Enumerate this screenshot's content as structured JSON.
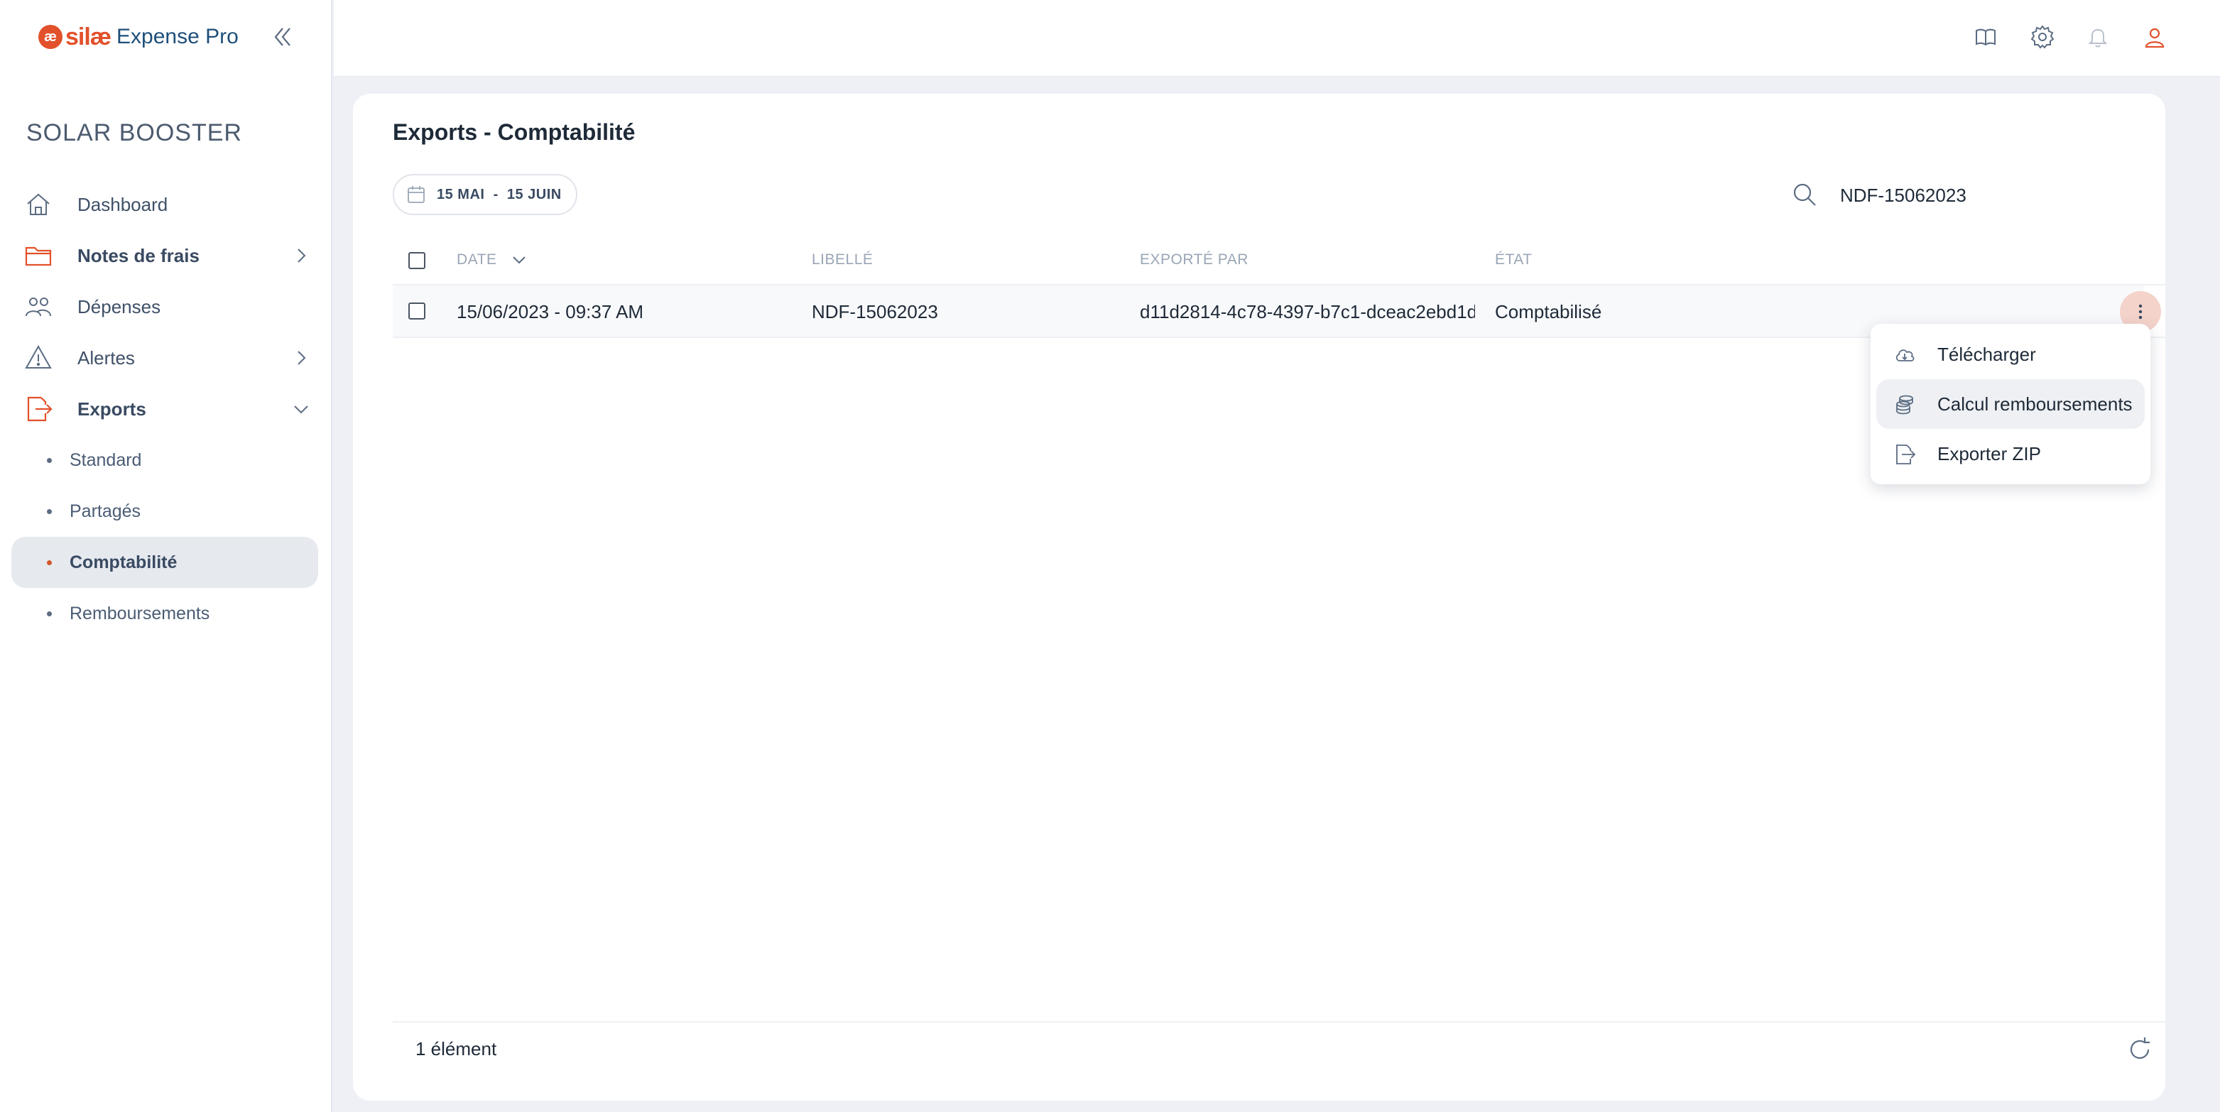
{
  "app": {
    "logo_mark": "æ",
    "logo_brand": "silæ",
    "logo_product": "Expense Pro",
    "org_name": "SOLAR BOOSTER"
  },
  "sidebar": {
    "items": [
      {
        "label": "Dashboard",
        "icon": "home-icon"
      },
      {
        "label": "Notes de frais",
        "icon": "folder-icon",
        "expandable": true
      },
      {
        "label": "Dépenses",
        "icon": "users-icon"
      },
      {
        "label": "Alertes",
        "icon": "warning-icon",
        "expandable": true
      },
      {
        "label": "Exports",
        "icon": "export-icon",
        "expanded": true
      }
    ],
    "sub_items": [
      {
        "label": "Standard"
      },
      {
        "label": "Partagés"
      },
      {
        "label": "Comptabilité",
        "active": true
      },
      {
        "label": "Remboursements"
      }
    ]
  },
  "topbar": {
    "icons": [
      "book-icon",
      "settings-icon",
      "bell-icon",
      "user-icon"
    ]
  },
  "page": {
    "title": "Exports - Comptabilité",
    "date_range": "15 MAI  -  15 JUIN",
    "search_value": "NDF-15062023"
  },
  "table": {
    "headers": {
      "date": "DATE",
      "libelle": "LIBELLÉ",
      "exporte_par": "EXPORTÉ PAR",
      "etat": "ÉTAT"
    },
    "rows": [
      {
        "date": "15/06/2023 - 09:37 AM",
        "libelle": "NDF-15062023",
        "exporte_par": "d11d2814-4c78-4397-b7c1-dceac2ebd1d",
        "etat": "Comptabilisé"
      }
    ]
  },
  "menu": {
    "items": [
      {
        "label": "Télécharger",
        "icon": "cloud-download-icon"
      },
      {
        "label": "Calcul remboursements",
        "icon": "coins-icon"
      },
      {
        "label": "Exporter ZIP",
        "icon": "file-export-icon"
      }
    ]
  },
  "footer": {
    "count": "1 élément"
  },
  "colors": {
    "accent": "#e2512b",
    "brand_blue": "#1f4f7a",
    "active_bg": "#e6eaef"
  }
}
